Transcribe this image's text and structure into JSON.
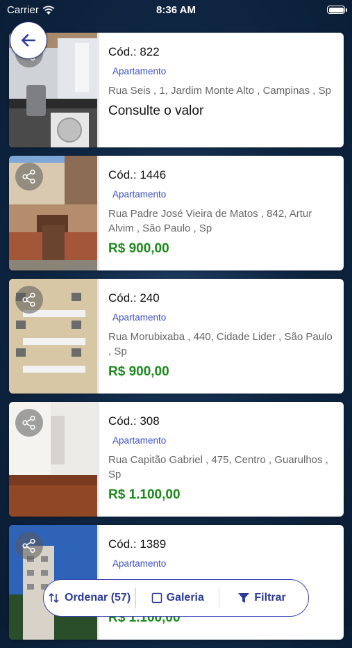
{
  "status_bar": {
    "carrier": "Carrier",
    "time": "8:36 AM"
  },
  "listings": [
    {
      "code": "Cód.: 822",
      "type": "Apartamento",
      "address": "Rua Seis , 1, Jardim Monte Alto , Campinas , Sp",
      "price": "Consulte o valor"
    },
    {
      "code": "Cód.: 1446",
      "type": "Apartamento",
      "address": "Rua Padre José Vieira de Matos , 842, Artur Alvim , São Paulo , Sp",
      "price": "R$ 900,00"
    },
    {
      "code": "Cód.: 240",
      "type": "Apartamento",
      "address": "Rua Morubixaba , 440, Cidade Lider , São Paulo , Sp",
      "price": "R$ 900,00"
    },
    {
      "code": "Cód.: 308",
      "type": "Apartamento",
      "address": "Rua Capitão Gabriel , 475, Centro , Guarulhos , Sp",
      "price": "R$ 1.100,00"
    },
    {
      "code": "Cód.: 1389",
      "type": "Apartamento",
      "address": "",
      "price": "R$ 1.100,00"
    }
  ],
  "bottom_bar": {
    "sort_label": "Ordenar (57)",
    "gallery_label": "Galeria",
    "filter_label": "Filtrar"
  },
  "colors": {
    "accent": "#2c3a9a",
    "price": "#1b8a1b",
    "type": "#3d4fc0",
    "background": "#0f2744"
  }
}
